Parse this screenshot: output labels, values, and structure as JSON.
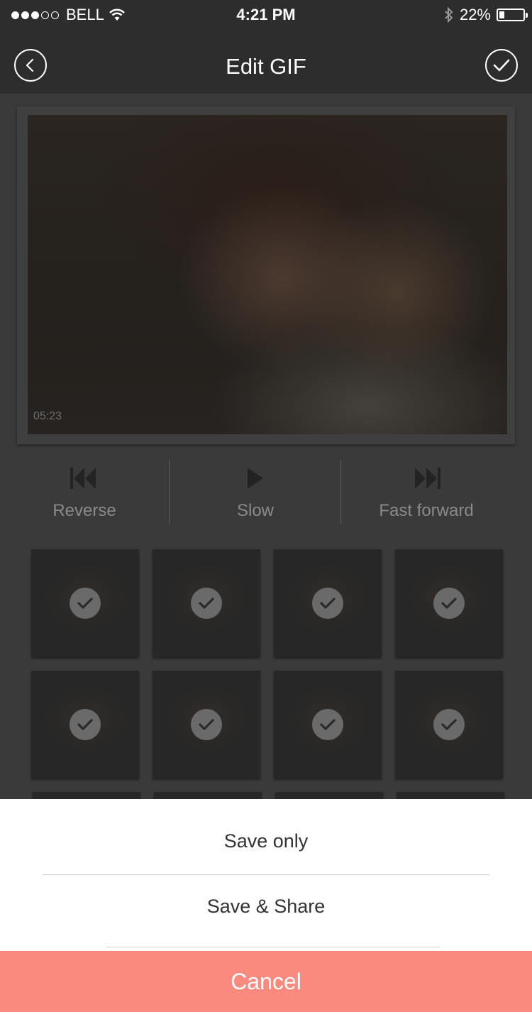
{
  "status_bar": {
    "carrier": "BELL",
    "time": "4:21 PM",
    "battery_percent": "22%",
    "battery_level": 0.22,
    "icons": [
      "signal-dots-icon",
      "wifi-icon",
      "bluetooth-icon",
      "battery-icon"
    ]
  },
  "nav": {
    "title": "Edit GIF",
    "back_icon": "chevron-left-icon",
    "done_icon": "checkmark-icon"
  },
  "preview": {
    "timestamp": "05:23"
  },
  "controls": [
    {
      "label": "Reverse",
      "icon": "rewind-icon"
    },
    {
      "label": "Slow",
      "icon": "play-icon"
    },
    {
      "label": "Fast forward",
      "icon": "fast-forward-icon"
    }
  ],
  "frames": {
    "count": 8,
    "all_selected": true,
    "check_icon": "checkmark-icon"
  },
  "action_sheet": {
    "options": [
      "Save only",
      "Save & Share"
    ],
    "cancel_label": "Cancel",
    "cancel_color": "#fb8a7e"
  }
}
